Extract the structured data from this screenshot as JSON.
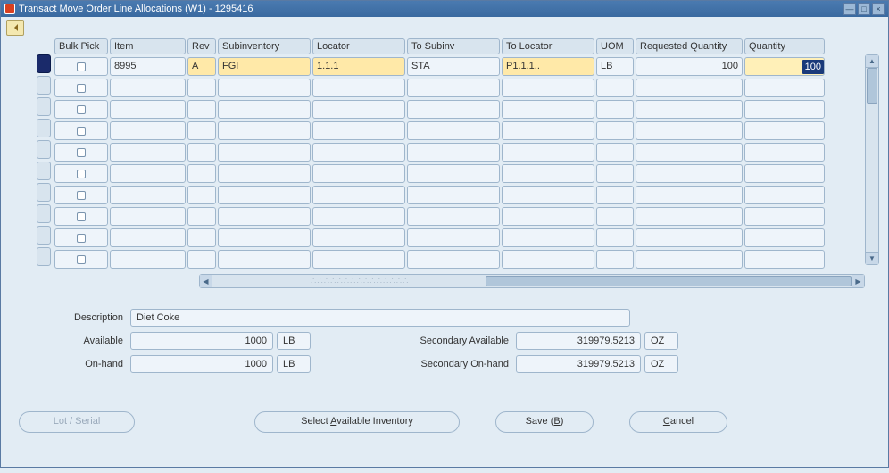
{
  "window": {
    "title": "Transact Move Order Line Allocations (W1) - 1295416"
  },
  "grid": {
    "headers": {
      "bulk_pick": "Bulk Pick",
      "item": "Item",
      "rev": "Rev",
      "subinventory": "Subinventory",
      "locator": "Locator",
      "to_subinv": "To Subinv",
      "to_locator": "To Locator",
      "uom": "UOM",
      "req_qty": "Requested Quantity",
      "qty": "Quantity"
    },
    "rows": [
      {
        "bulk_pick": false,
        "item": "8995",
        "rev": "A",
        "subinventory": "FGI",
        "locator": "1.1.1",
        "to_subinv": "STA",
        "to_locator": "P1.1.1..",
        "uom": "LB",
        "req_qty": "100",
        "qty": "100"
      }
    ]
  },
  "details": {
    "description_label": "Description",
    "description": "Diet Coke",
    "available_label": "Available",
    "available": "1000",
    "available_uom": "LB",
    "onhand_label": "On-hand",
    "onhand": "1000",
    "onhand_uom": "LB",
    "sec_available_label": "Secondary Available",
    "sec_available": "319979.5213",
    "sec_available_uom": "OZ",
    "sec_onhand_label": "Secondary On-hand",
    "sec_onhand": "319979.5213",
    "sec_onhand_uom": "OZ"
  },
  "buttons": {
    "lot_serial": "Lot / Serial",
    "select_inv_pre": "Select ",
    "select_inv_u": "A",
    "select_inv_post": "vailable Inventory",
    "save_pre": "Save (",
    "save_u": "B",
    "save_post": ")",
    "cancel_pre": "",
    "cancel_u": "C",
    "cancel_post": "ancel"
  }
}
